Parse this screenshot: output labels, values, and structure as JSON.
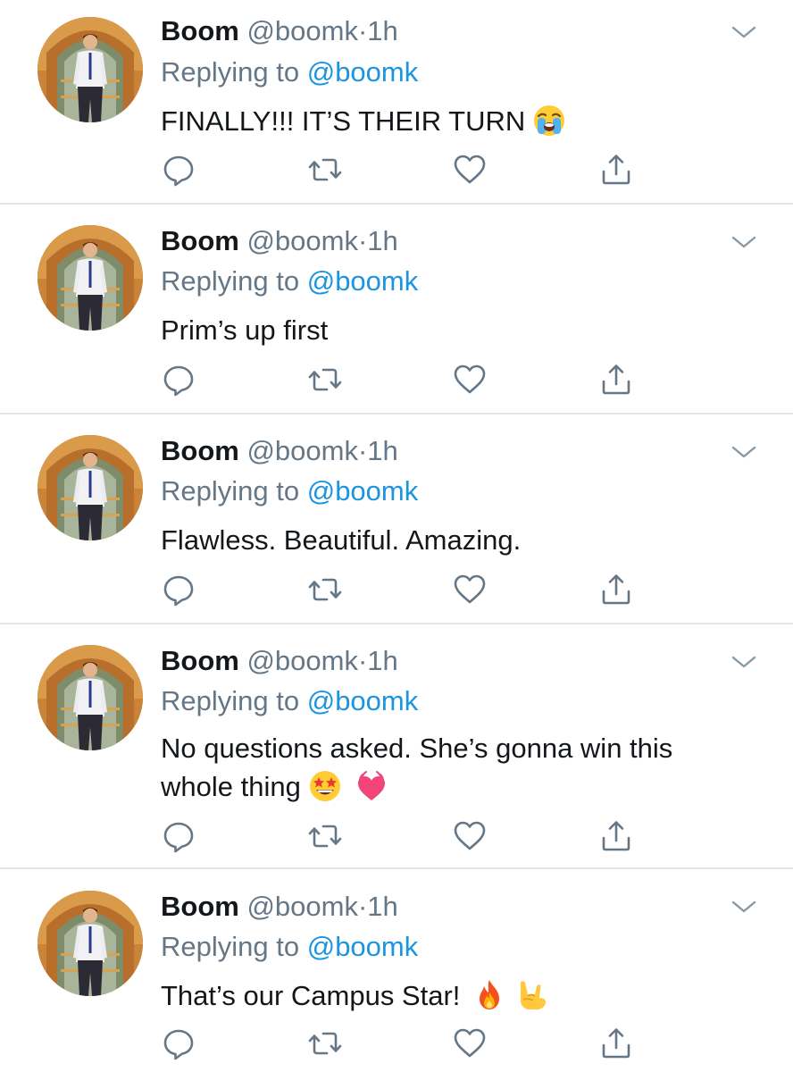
{
  "tweets": [
    {
      "name": "Boom",
      "handle": "@boomk",
      "dot": "·",
      "time": "1h",
      "replying_prefix": "Replying to",
      "replying_to": "@boomk",
      "text": "FINALLY!!! IT’S THEIR TURN",
      "emojis": [
        "loudly-crying-face"
      ]
    },
    {
      "name": "Boom",
      "handle": "@boomk",
      "dot": "·",
      "time": "1h",
      "replying_prefix": "Replying to",
      "replying_to": "@boomk",
      "text": "Prim’s up first",
      "emojis": []
    },
    {
      "name": "Boom",
      "handle": "@boomk",
      "dot": "·",
      "time": "1h",
      "replying_prefix": "Replying to",
      "replying_to": "@boomk",
      "text": "Flawless. Beautiful. Amazing.",
      "emojis": []
    },
    {
      "name": "Boom",
      "handle": "@boomk",
      "dot": "·",
      "time": "1h",
      "replying_prefix": "Replying to",
      "replying_to": "@boomk",
      "text_line1": "No questions asked. She’s gonna win this",
      "text_line2": "whole thing",
      "emojis": [
        "star-struck-face",
        "growing-heart"
      ]
    },
    {
      "name": "Boom",
      "handle": "@boomk",
      "dot": "·",
      "time": "1h",
      "replying_prefix": "Replying to",
      "replying_to": "@boomk",
      "text": "That’s our Campus Star!",
      "emojis": [
        "fire",
        "sign-of-the-horns"
      ]
    }
  ],
  "icons": {
    "reply": "reply-icon",
    "retweet": "retweet-icon",
    "like": "heart-icon",
    "share": "share-icon",
    "more": "chevron-down-icon"
  },
  "colors": {
    "text_primary": "#14171a",
    "text_secondary": "#657786",
    "link": "#1b95e0",
    "divider": "#e1e8ed",
    "icon": "#657786"
  }
}
